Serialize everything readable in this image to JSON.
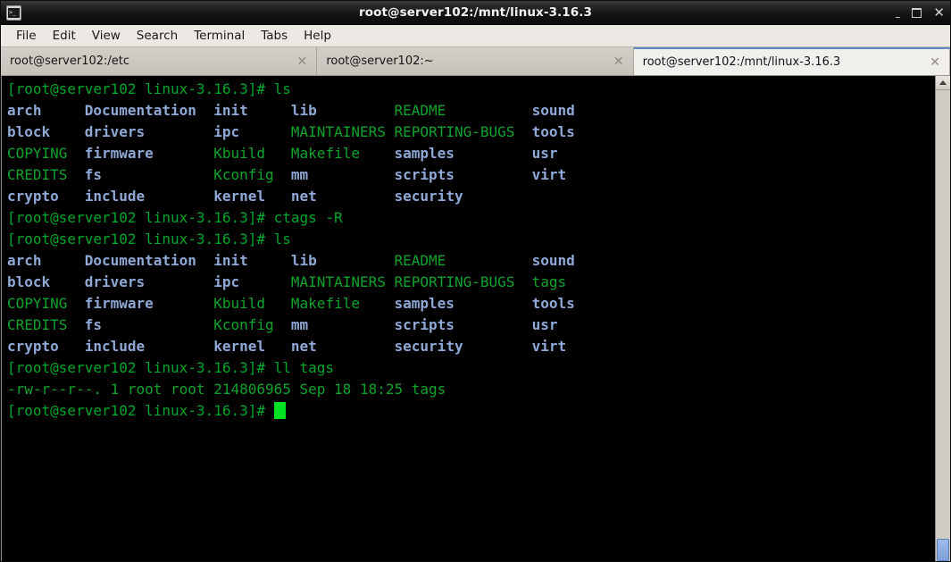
{
  "window": {
    "title": "root@server102:/mnt/linux-3.16.3",
    "icon_name": "terminal-icon",
    "icon_glyph": ">_",
    "controls": {
      "minimize": "–",
      "maximize": "",
      "close": "✕"
    }
  },
  "menubar": {
    "items": [
      {
        "label": "File"
      },
      {
        "label": "Edit"
      },
      {
        "label": "View"
      },
      {
        "label": "Search"
      },
      {
        "label": "Terminal"
      },
      {
        "label": "Tabs"
      },
      {
        "label": "Help"
      }
    ]
  },
  "tabs": [
    {
      "label": "root@server102:/etc",
      "active": false,
      "close_glyph": "✕"
    },
    {
      "label": "root@server102:~",
      "active": false,
      "close_glyph": "✕"
    },
    {
      "label": "root@server102:/mnt/linux-3.16.3",
      "active": true,
      "close_glyph": "✕"
    }
  ],
  "scrollbar": {
    "up_arrow": "▲",
    "down_arrow": "▼"
  },
  "terminal": {
    "prompt": "[root@server102 linux-3.16.3]#",
    "colors": {
      "background": "#000000",
      "prompt_green": "#00a62b",
      "file_green": "#0fa32c",
      "dir_blue": "#8fa8d6",
      "plain_gray": "#b8b8b8",
      "cursor_green": "#00e023"
    },
    "cursor": {
      "shape": "block",
      "visible": true
    },
    "lines": [
      {
        "type": "command",
        "prompt": "[root@server102 linux-3.16.3]#",
        "command": " ls"
      },
      {
        "type": "listing",
        "cells": [
          {
            "text": "arch",
            "kind": "dir"
          },
          {
            "text": "Documentation",
            "kind": "dir"
          },
          {
            "text": "init",
            "kind": "dir"
          },
          {
            "text": "lib",
            "kind": "dir"
          },
          {
            "text": "README",
            "kind": "file"
          },
          {
            "text": "sound",
            "kind": "dir"
          }
        ]
      },
      {
        "type": "listing",
        "cells": [
          {
            "text": "block",
            "kind": "dir"
          },
          {
            "text": "drivers",
            "kind": "dir"
          },
          {
            "text": "ipc",
            "kind": "dir"
          },
          {
            "text": "MAINTAINERS",
            "kind": "file"
          },
          {
            "text": "REPORTING-BUGS",
            "kind": "file"
          },
          {
            "text": "tools",
            "kind": "dir"
          }
        ]
      },
      {
        "type": "listing",
        "cells": [
          {
            "text": "COPYING",
            "kind": "file"
          },
          {
            "text": "firmware",
            "kind": "dir"
          },
          {
            "text": "Kbuild",
            "kind": "file"
          },
          {
            "text": "Makefile",
            "kind": "file"
          },
          {
            "text": "samples",
            "kind": "dir"
          },
          {
            "text": "usr",
            "kind": "dir"
          }
        ]
      },
      {
        "type": "listing",
        "cells": [
          {
            "text": "CREDITS",
            "kind": "file"
          },
          {
            "text": "fs",
            "kind": "dir"
          },
          {
            "text": "Kconfig",
            "kind": "file"
          },
          {
            "text": "mm",
            "kind": "dir"
          },
          {
            "text": "scripts",
            "kind": "dir"
          },
          {
            "text": "virt",
            "kind": "dir"
          }
        ]
      },
      {
        "type": "listing",
        "cells": [
          {
            "text": "crypto",
            "kind": "dir"
          },
          {
            "text": "include",
            "kind": "dir"
          },
          {
            "text": "kernel",
            "kind": "dir"
          },
          {
            "text": "net",
            "kind": "dir"
          },
          {
            "text": "security",
            "kind": "dir"
          },
          {
            "text": "",
            "kind": "dir"
          }
        ]
      },
      {
        "type": "command",
        "prompt": "[root@server102 linux-3.16.3]#",
        "command": " ctags -R"
      },
      {
        "type": "command",
        "prompt": "[root@server102 linux-3.16.3]#",
        "command": " ls"
      },
      {
        "type": "listing",
        "cells": [
          {
            "text": "arch",
            "kind": "dir"
          },
          {
            "text": "Documentation",
            "kind": "dir"
          },
          {
            "text": "init",
            "kind": "dir"
          },
          {
            "text": "lib",
            "kind": "dir"
          },
          {
            "text": "README",
            "kind": "file"
          },
          {
            "text": "sound",
            "kind": "dir"
          }
        ]
      },
      {
        "type": "listing",
        "cells": [
          {
            "text": "block",
            "kind": "dir"
          },
          {
            "text": "drivers",
            "kind": "dir"
          },
          {
            "text": "ipc",
            "kind": "dir"
          },
          {
            "text": "MAINTAINERS",
            "kind": "file"
          },
          {
            "text": "REPORTING-BUGS",
            "kind": "file"
          },
          {
            "text": "tags",
            "kind": "file"
          }
        ]
      },
      {
        "type": "listing",
        "cells": [
          {
            "text": "COPYING",
            "kind": "file"
          },
          {
            "text": "firmware",
            "kind": "dir"
          },
          {
            "text": "Kbuild",
            "kind": "file"
          },
          {
            "text": "Makefile",
            "kind": "file"
          },
          {
            "text": "samples",
            "kind": "dir"
          },
          {
            "text": "tools",
            "kind": "dir"
          }
        ]
      },
      {
        "type": "listing",
        "cells": [
          {
            "text": "CREDITS",
            "kind": "file"
          },
          {
            "text": "fs",
            "kind": "dir"
          },
          {
            "text": "Kconfig",
            "kind": "file"
          },
          {
            "text": "mm",
            "kind": "dir"
          },
          {
            "text": "scripts",
            "kind": "dir"
          },
          {
            "text": "usr",
            "kind": "dir"
          }
        ]
      },
      {
        "type": "listing",
        "cells": [
          {
            "text": "crypto",
            "kind": "dir"
          },
          {
            "text": "include",
            "kind": "dir"
          },
          {
            "text": "kernel",
            "kind": "dir"
          },
          {
            "text": "net",
            "kind": "dir"
          },
          {
            "text": "security",
            "kind": "dir"
          },
          {
            "text": "virt",
            "kind": "dir"
          }
        ]
      },
      {
        "type": "command",
        "prompt": "[root@server102 linux-3.16.3]#",
        "command": " ll tags"
      },
      {
        "type": "output",
        "text": "-rw-r--r--. 1 root root 214806965 Sep 18 18:25 tags",
        "kind": "file"
      },
      {
        "type": "cursor-line",
        "prompt": "[root@server102 linux-3.16.3]#",
        "command": " "
      }
    ]
  }
}
